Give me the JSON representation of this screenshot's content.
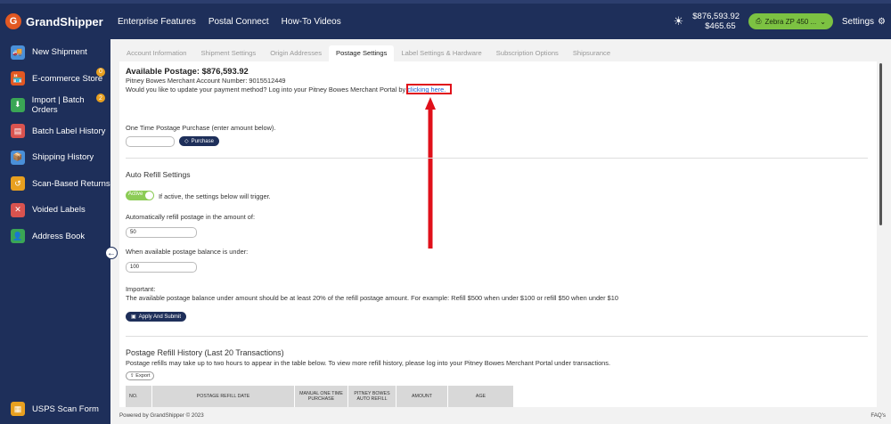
{
  "brand": {
    "name": "GrandShipper"
  },
  "topnav": [
    "Enterprise Features",
    "Postal Connect",
    "How-To Videos"
  ],
  "header": {
    "balance_1": "$876,593.92",
    "balance_2": "$465.65",
    "printer": "Zebra ZP 450 ...",
    "settings": "Settings"
  },
  "sidebar": {
    "items": [
      {
        "label": "New Shipment",
        "icon": "truck-icon",
        "color": "#4a90d9"
      },
      {
        "label": "E-commerce Store",
        "icon": "store-icon",
        "color": "#e25822",
        "badge": "0"
      },
      {
        "label": "Import | Batch Orders",
        "icon": "import-icon",
        "color": "#3aa655",
        "badge": "2"
      },
      {
        "label": "Batch Label History",
        "icon": "batch-icon",
        "color": "#d9534f"
      },
      {
        "label": "Shipping History",
        "icon": "shipping-history-icon",
        "color": "#4a90d9"
      },
      {
        "label": "Scan-Based Returns",
        "icon": "returns-icon",
        "color": "#e8a020"
      },
      {
        "label": "Voided Labels",
        "icon": "voided-icon",
        "color": "#d9534f"
      },
      {
        "label": "Address Book",
        "icon": "address-book-icon",
        "color": "#3aa655"
      }
    ],
    "bottom": "USPS Scan Form"
  },
  "tabs": [
    "Account Information",
    "Shipment Settings",
    "Origin Addresses",
    "Postage Settings",
    "Label Settings & Hardware",
    "Subscription Options",
    "Shipsurance"
  ],
  "active_tab": "Postage Settings",
  "postage": {
    "available": "Available Postage: $876,593.92",
    "account_number": "Pitney Bowes Merchant Account Number: 9015512449",
    "update_text": "Would you like to update your payment method? Log into your Pitney Bowes Merchant Portal by",
    "link": "clicking here.",
    "one_time_label": "One Time Postage Purchase (enter amount below).",
    "purchase_btn": "Purchase"
  },
  "auto_refill": {
    "title": "Auto Refill Settings",
    "toggle_label": "Active",
    "toggle_text": "If active, the settings below will trigger.",
    "refill_amount_label": "Automatically refill postage in the amount of:",
    "refill_amount_value": "50",
    "balance_under_label": "When available postage balance is under:",
    "balance_under_value": "100",
    "important_label": "Important:",
    "important_text": "The available postage balance under amount should be at least 20% of the refill postage amount. For example: Refill $500 when under $100 or refill $50 when under $10",
    "apply_btn": "Apply And Submit"
  },
  "history": {
    "title": "Postage Refill History (Last 20 Transactions)",
    "subtitle": "Postage refills may take up to two hours to appear in the table below. To view more refill history, please log into your Pitney Bowes Merchant Portal under transactions.",
    "export_btn": "Export",
    "columns": [
      "NO.",
      "POSTAGE REFILL DATE",
      "MANUAL ONE TIME PURCHASE",
      "PITNEY BOWES AUTO REFILL",
      "AMOUNT",
      "AGE"
    ]
  },
  "footer": {
    "text": "Powered by GrandShipper © 2023",
    "faq": "FAQ's"
  }
}
